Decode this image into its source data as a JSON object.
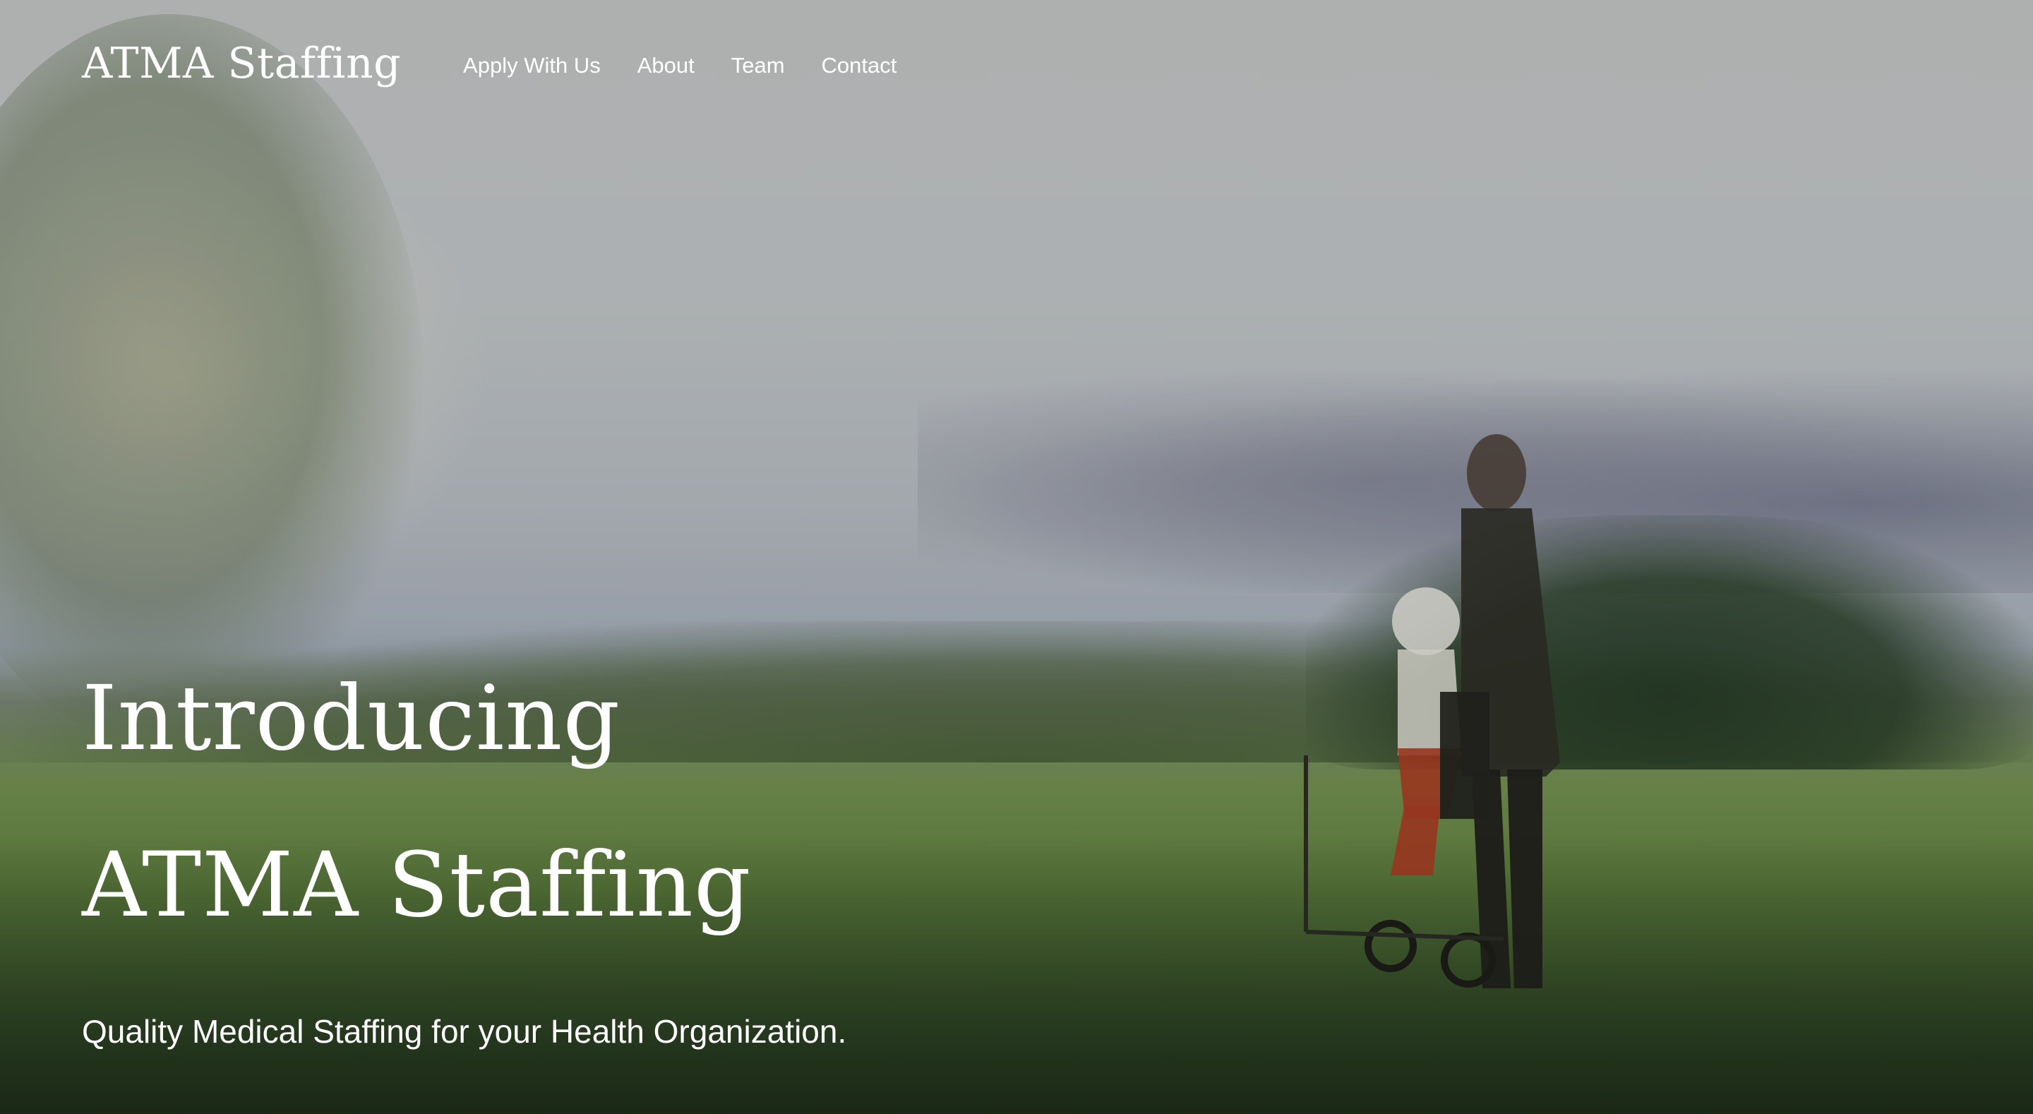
{
  "header": {
    "logo": "ATMA Staffing",
    "nav": [
      {
        "label": "Apply With Us"
      },
      {
        "label": "About"
      },
      {
        "label": "Team"
      },
      {
        "label": "Contact"
      }
    ]
  },
  "hero": {
    "title_line_1": "Introducing",
    "title_line_2": "ATMA Staffing",
    "subtitle": "Quality Medical Staffing for your Health Organization."
  }
}
